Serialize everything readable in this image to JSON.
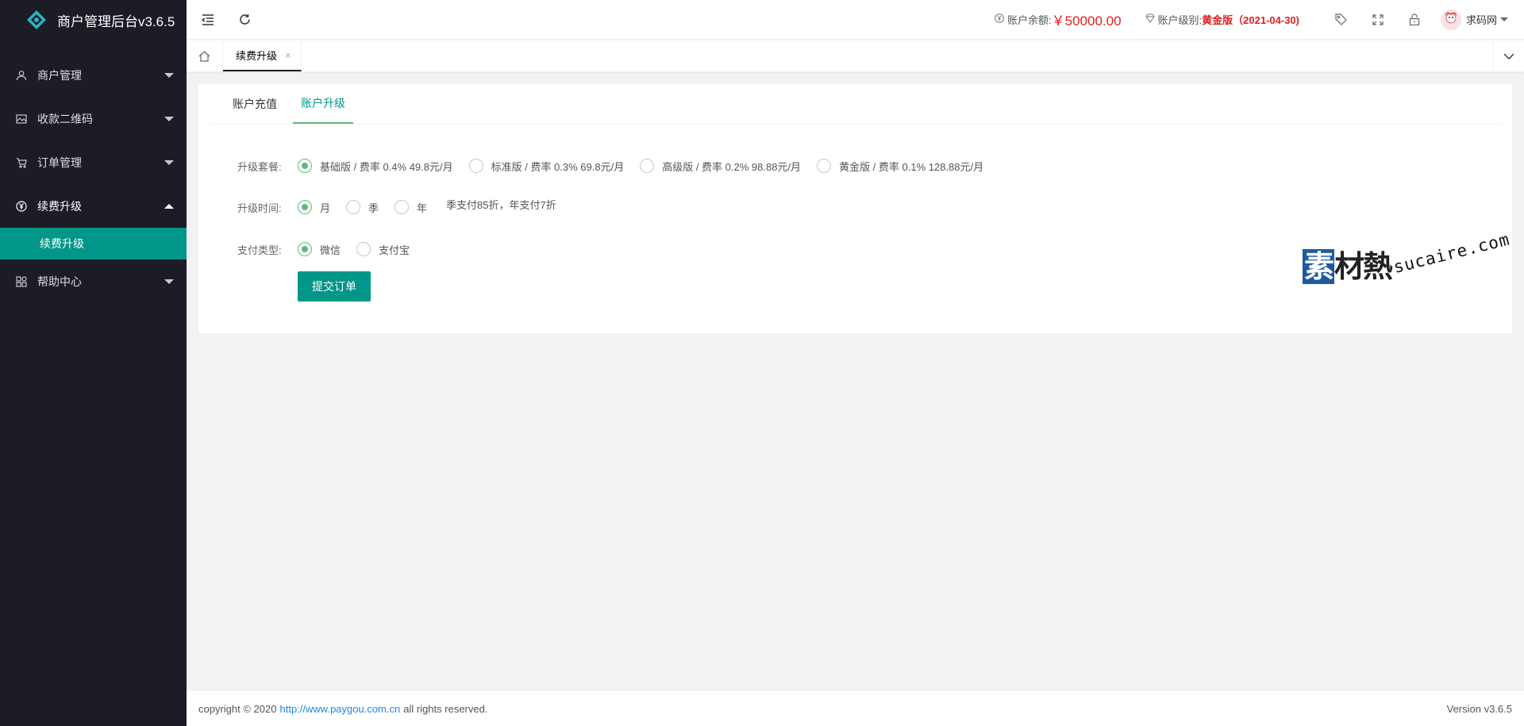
{
  "app": {
    "title": "商户管理后台v3.6.5"
  },
  "sidebar": {
    "items": [
      {
        "label": "商户管理",
        "icon": "user-icon"
      },
      {
        "label": "收款二维码",
        "icon": "image-icon"
      },
      {
        "label": "订单管理",
        "icon": "cart-icon"
      },
      {
        "label": "续费升级",
        "icon": "yen-circle-icon"
      },
      {
        "label": "帮助中心",
        "icon": "apps-icon"
      }
    ],
    "sub_item": {
      "label": "续费升级"
    }
  },
  "header": {
    "balance_label": "账户余额:",
    "balance_value": "￥50000.00",
    "level_label": "账户级别:",
    "level_value": "黄金版（2021-04-30)",
    "username": "求码网"
  },
  "tabbar": {
    "active_tab": "续费升级",
    "close_glyph": "×"
  },
  "card": {
    "tabs": [
      {
        "label": "账户充值",
        "active": false
      },
      {
        "label": "账户升级",
        "active": true
      }
    ],
    "form": {
      "package_label": "升级套餐:",
      "packages": [
        {
          "label": "基础版 / 费率 0.4% 49.8元/月",
          "checked": true
        },
        {
          "label": "标准版 / 费率 0.3% 69.8元/月",
          "checked": false
        },
        {
          "label": "高级版 / 费率 0.2% 98.88元/月",
          "checked": false
        },
        {
          "label": "黄金版 / 费率 0.1% 128.88元/月",
          "checked": false
        }
      ],
      "time_label": "升级时间:",
      "times": [
        {
          "label": "月",
          "checked": true
        },
        {
          "label": "季",
          "checked": false
        },
        {
          "label": "年",
          "checked": false
        }
      ],
      "time_hint": "季支付85折，年支付7折",
      "pay_label": "支付类型:",
      "pay_types": [
        {
          "label": "微信",
          "checked": true
        },
        {
          "label": "支付宝",
          "checked": false
        }
      ],
      "submit_label": "提交订单"
    },
    "watermark": {
      "cn_first": "素",
      "cn_rest": "材熱",
      "en": "sucaire.com"
    }
  },
  "footer": {
    "copyright_prefix": "copyright © 2020",
    "link": "http://www.paygou.com.cn",
    "copyright_suffix": "all rights reserved.",
    "version": "Version v3.6.5"
  },
  "colors": {
    "sidebar_bg": "#1b1c26",
    "accent": "#009688",
    "radio_green": "#5fb878",
    "alert_red": "#e02020",
    "link_blue": "#1e88e5"
  }
}
